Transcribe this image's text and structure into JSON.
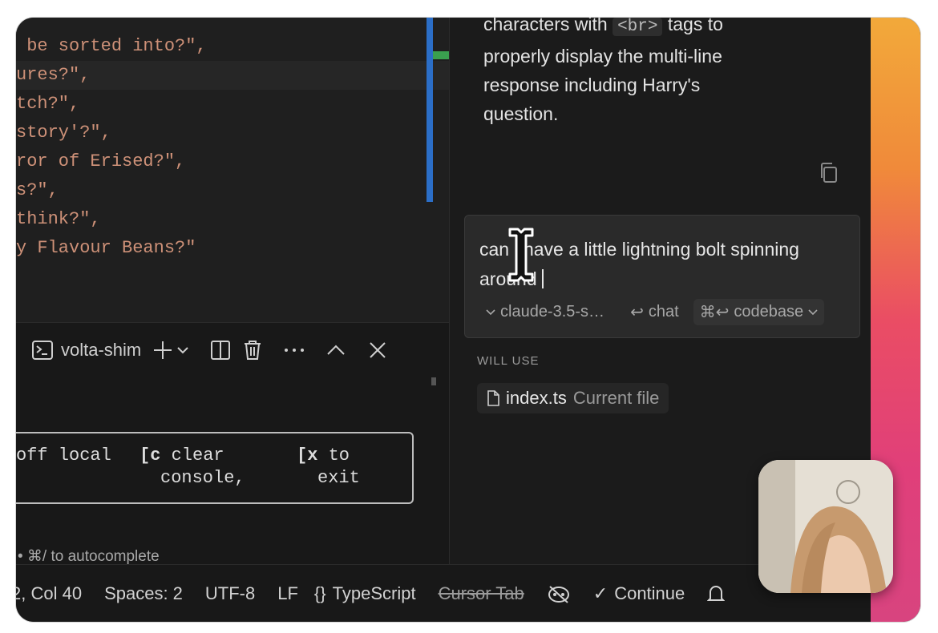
{
  "editor": {
    "lines": [
      {
        "text": ",",
        "active": false
      },
      {
        "text": " be sorted into?\",",
        "active": false
      },
      {
        "text": "ures?\",",
        "active": true
      },
      {
        "text": "tch?\",",
        "active": false
      },
      {
        "text": "story'?\",",
        "active": false
      },
      {
        "text": "ror of Erised?\",",
        "active": false
      },
      {
        "text": "s?\",",
        "active": false
      },
      {
        "text": "think?\",",
        "active": false
      },
      {
        "text": "y Flavour Beans?\"",
        "active": false
      }
    ]
  },
  "terminal": {
    "name": "volta-shim",
    "icons": [
      "terminal-icon",
      "plus-icon",
      "chevron-down-icon",
      "split-icon",
      "trash-icon",
      "more-icon",
      "chevron-up-icon",
      "close-icon"
    ],
    "box": {
      "col1": "off local",
      "col2_key": "[c",
      "col2_a": " clear",
      "col2_b": "console,",
      "col3_key": "[x",
      "col3_a": " to",
      "col3_b": "exit"
    },
    "hint": "• ⌘/ to autocomplete"
  },
  "chat": {
    "response": {
      "line1_pre": "characters with",
      "line1_code": "<br>",
      "line1_post": "tags to",
      "line2": "properly display the multi-line",
      "line3": "response including Harry's",
      "line4": "question."
    },
    "input": {
      "text": "can i have a little lightning bolt spinning around",
      "model": "claude-3.5-s…",
      "chat_label": "chat",
      "codebase_label": "codebase",
      "codebase_shortcut": "⌘↩"
    },
    "will_use_label": "WILL USE",
    "file": {
      "name": "index.ts",
      "note": "Current file"
    }
  },
  "statusbar": {
    "position": "2, Col 40",
    "spaces": "Spaces: 2",
    "encoding": "UTF-8",
    "eol": "LF",
    "language": "TypeScript",
    "cursor_tab": "Cursor Tab",
    "continue": "Continue"
  }
}
